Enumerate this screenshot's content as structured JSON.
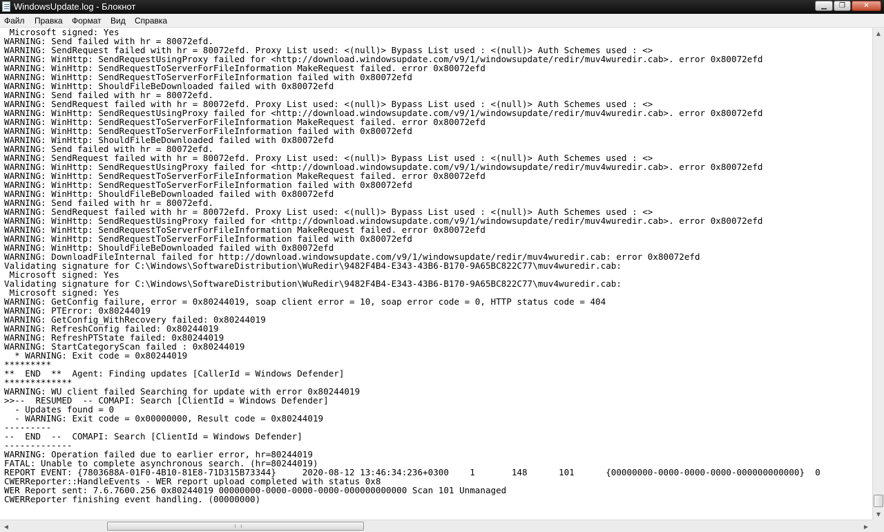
{
  "window": {
    "title": "WindowsUpdate.log - Блокнот"
  },
  "menu": [
    "Файл",
    "Правка",
    "Формат",
    "Вид",
    "Справка"
  ],
  "log_lines": [
    " Microsoft signed: Yes",
    "WARNING: Send failed with hr = 80072efd.",
    "WARNING: SendRequest failed with hr = 80072efd. Proxy List used: <(null)> Bypass List used : <(null)> Auth Schemes used : <>",
    "WARNING: WinHttp: SendRequestUsingProxy failed for <http://download.windowsupdate.com/v9/1/windowsupdate/redir/muv4wuredir.cab>. error 0x80072efd",
    "WARNING: WinHttp: SendRequestToServerForFileInformation MakeRequest failed. error 0x80072efd",
    "WARNING: WinHttp: SendRequestToServerForFileInformation failed with 0x80072efd",
    "WARNING: WinHttp: ShouldFileBeDownloaded failed with 0x80072efd",
    "WARNING: Send failed with hr = 80072efd.",
    "WARNING: SendRequest failed with hr = 80072efd. Proxy List used: <(null)> Bypass List used : <(null)> Auth Schemes used : <>",
    "WARNING: WinHttp: SendRequestUsingProxy failed for <http://download.windowsupdate.com/v9/1/windowsupdate/redir/muv4wuredir.cab>. error 0x80072efd",
    "WARNING: WinHttp: SendRequestToServerForFileInformation MakeRequest failed. error 0x80072efd",
    "WARNING: WinHttp: SendRequestToServerForFileInformation failed with 0x80072efd",
    "WARNING: WinHttp: ShouldFileBeDownloaded failed with 0x80072efd",
    "WARNING: Send failed with hr = 80072efd.",
    "WARNING: SendRequest failed with hr = 80072efd. Proxy List used: <(null)> Bypass List used : <(null)> Auth Schemes used : <>",
    "WARNING: WinHttp: SendRequestUsingProxy failed for <http://download.windowsupdate.com/v9/1/windowsupdate/redir/muv4wuredir.cab>. error 0x80072efd",
    "WARNING: WinHttp: SendRequestToServerForFileInformation MakeRequest failed. error 0x80072efd",
    "WARNING: WinHttp: SendRequestToServerForFileInformation failed with 0x80072efd",
    "WARNING: WinHttp: ShouldFileBeDownloaded failed with 0x80072efd",
    "WARNING: Send failed with hr = 80072efd.",
    "WARNING: SendRequest failed with hr = 80072efd. Proxy List used: <(null)> Bypass List used : <(null)> Auth Schemes used : <>",
    "WARNING: WinHttp: SendRequestUsingProxy failed for <http://download.windowsupdate.com/v9/1/windowsupdate/redir/muv4wuredir.cab>. error 0x80072efd",
    "WARNING: WinHttp: SendRequestToServerForFileInformation MakeRequest failed. error 0x80072efd",
    "WARNING: WinHttp: SendRequestToServerForFileInformation failed with 0x80072efd",
    "WARNING: WinHttp: ShouldFileBeDownloaded failed with 0x80072efd",
    "WARNING: DownloadFileInternal failed for http://download.windowsupdate.com/v9/1/windowsupdate/redir/muv4wuredir.cab: error 0x80072efd",
    "Validating signature for C:\\Windows\\SoftwareDistribution\\WuRedir\\9482F4B4-E343-43B6-B170-9A65BC822C77\\muv4wuredir.cab:",
    " Microsoft signed: Yes",
    "Validating signature for C:\\Windows\\SoftwareDistribution\\WuRedir\\9482F4B4-E343-43B6-B170-9A65BC822C77\\muv4wuredir.cab:",
    " Microsoft signed: Yes",
    "WARNING: GetConfig failure, error = 0x80244019, soap client error = 10, soap error code = 0, HTTP status code = 404",
    "WARNING: PTError: 0x80244019",
    "WARNING: GetConfig_WithRecovery failed: 0x80244019",
    "WARNING: RefreshConfig failed: 0x80244019",
    "WARNING: RefreshPTState failed: 0x80244019",
    "WARNING: StartCategoryScan failed : 0x80244019",
    "  * WARNING: Exit code = 0x80244019",
    "*********",
    "**  END  **  Agent: Finding updates [CallerId = Windows Defender]",
    "*************",
    "WARNING: WU client failed Searching for update with error 0x80244019",
    ">>--  RESUMED  -- COMAPI: Search [ClientId = Windows Defender]",
    "  - Updates found = 0",
    "  - WARNING: Exit code = 0x00000000, Result code = 0x80244019",
    "---------",
    "--  END  --  COMAPI: Search [ClientId = Windows Defender]",
    "-------------",
    "WARNING: Operation failed due to earlier error, hr=80244019",
    "FATAL: Unable to complete asynchronous search. (hr=80244019)",
    "REPORT EVENT: {7803688A-01F0-4B10-81E8-71D315B73344}     2020-08-12 13:46:34:236+0300    1       148      101      {00000000-0000-0000-0000-000000000000}  0",
    "CWERReporter::HandleEvents - WER report upload completed with status 0x8",
    "WER Report sent: 7.6.7600.256 0x80244019 00000000-0000-0000-0000-000000000000 Scan 101 Unmanaged",
    "CWERReporter finishing event handling. (00000000)"
  ],
  "icons": {
    "app": "notepad-icon",
    "minimize": "minimize-icon",
    "maximize": "maximize-icon",
    "close": "close-icon",
    "scroll_up": "arrow-up-icon",
    "scroll_down": "arrow-down-icon",
    "scroll_left": "arrow-left-icon",
    "scroll_right": "arrow-right-icon"
  }
}
